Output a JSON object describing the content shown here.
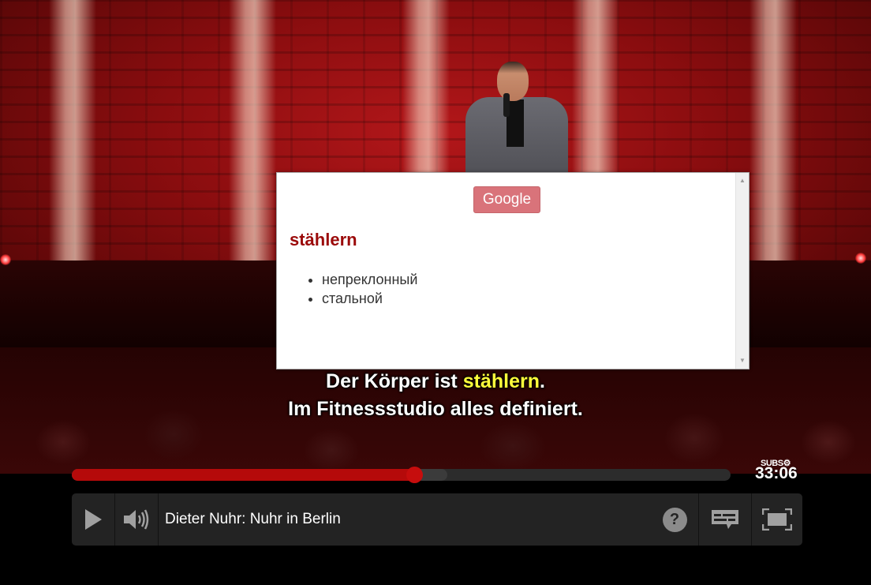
{
  "subtitle": {
    "line1_before": "Der Körper ist ",
    "line1_highlight": "stählern",
    "line1_after": ".",
    "line2": "Im Fitnessstudio alles definiert.",
    "highlight_color": "#ffff3b"
  },
  "dictionary_popup": {
    "google_button_label": "Google",
    "word": "stählern",
    "translations": [
      "непреклонный",
      "стальной"
    ],
    "word_color": "#9b0a0a",
    "button_color": "#d9737a"
  },
  "player": {
    "progress_fraction": 0.52,
    "buffered_fraction": 0.57,
    "time": "33:06",
    "subs_settings_label": "SUBS",
    "title": "Dieter Nuhr: Nuhr in Berlin",
    "accent_color": "#b50a0a",
    "icons": [
      "play-icon",
      "volume-icon",
      "help-icon",
      "subtitles-icon",
      "fullscreen-icon",
      "gear-icon"
    ]
  }
}
